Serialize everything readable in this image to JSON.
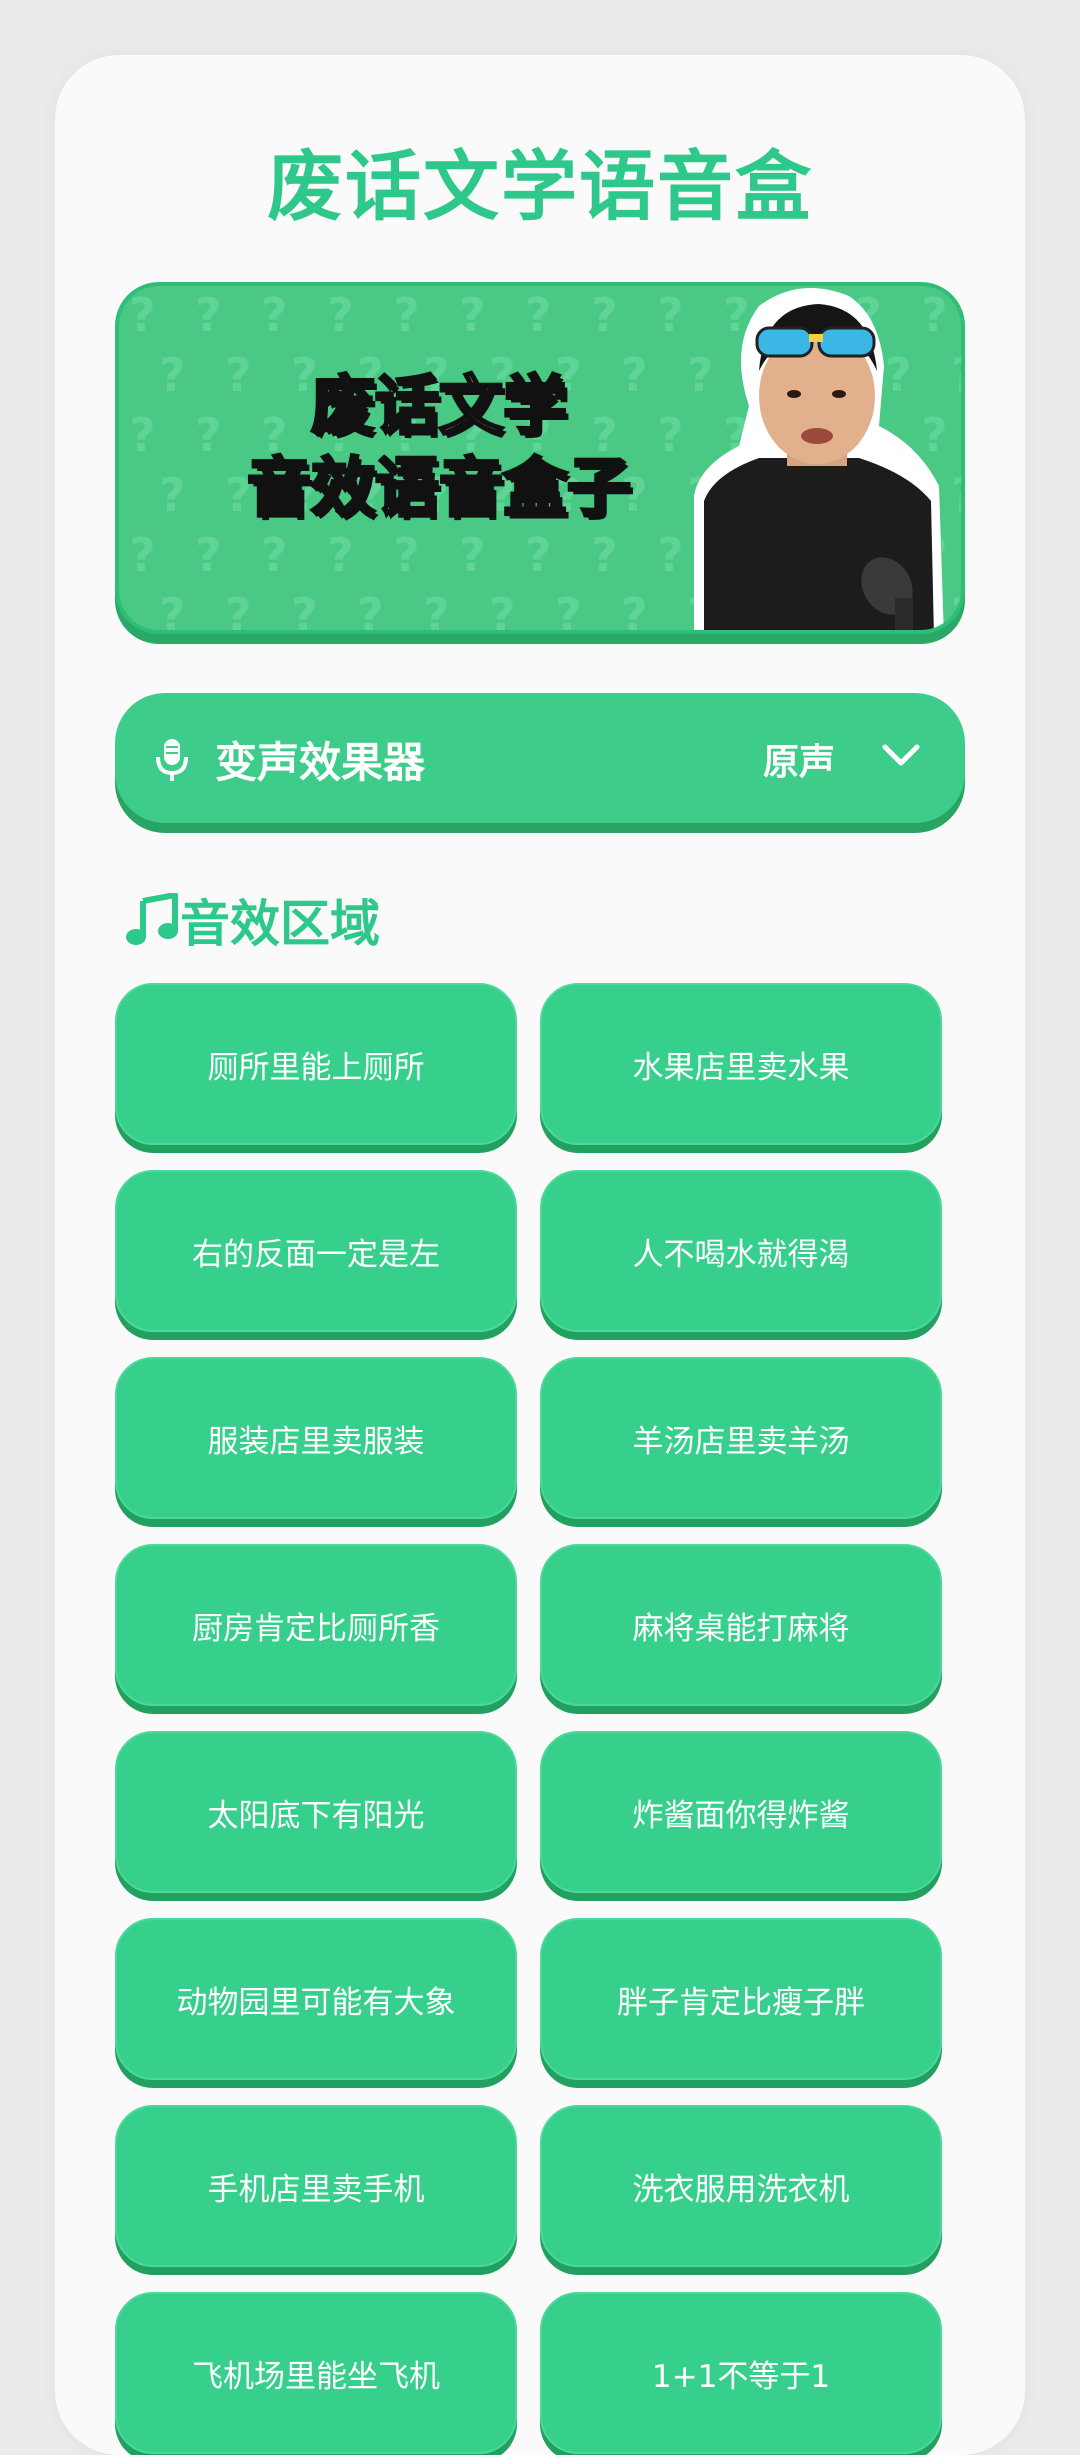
{
  "app": {
    "title": "废话文学语音盒"
  },
  "banner": {
    "line1": "废话文学",
    "line2": "音效语音盒子"
  },
  "voice_changer": {
    "label": "变声效果器",
    "value": "原声",
    "icons": [
      "microphone-icon",
      "chevron-down-icon"
    ]
  },
  "section": {
    "title": "音效区域",
    "icon": "music-note-icon"
  },
  "sounds": [
    "厕所里能上厕所",
    "水果店里卖水果",
    "右的反面一定是左",
    "人不喝水就得渴",
    "服装店里卖服装",
    "羊汤店里卖羊汤",
    "厨房肯定比厕所香",
    "麻将桌能打麻将",
    "太阳底下有阳光",
    "炸酱面你得炸酱",
    "动物园里可能有大象",
    "胖子肯定比瘦子胖",
    "手机店里卖手机",
    "洗衣服用洗衣机",
    "飞机场里能坐飞机",
    "1+1不等于1"
  ],
  "colors": {
    "accent": "#2ec98a",
    "button": "#36cf8c",
    "button_shadow": "#22a060",
    "background": "#fafafa"
  }
}
